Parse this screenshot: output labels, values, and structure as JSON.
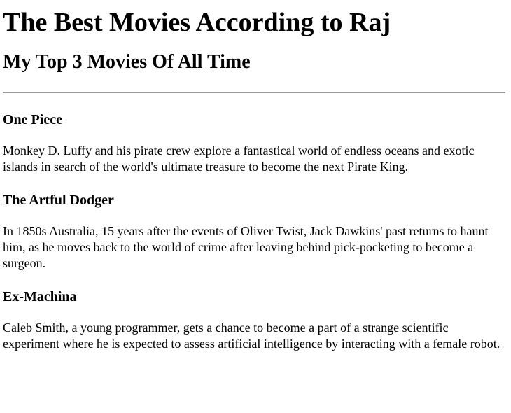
{
  "header": {
    "title": "The Best Movies According to Raj",
    "subtitle": "My Top 3 Movies Of All Time"
  },
  "movies": [
    {
      "title": "One Piece",
      "description": "Monkey D. Luffy and his pirate crew explore a fantastical world of endless oceans and exotic islands in search of the world's ultimate treasure to become the next Pirate King."
    },
    {
      "title": "The Artful Dodger",
      "description": "In 1850s Australia, 15 years after the events of Oliver Twist, Jack Dawkins' past returns to haunt him, as he moves back to the world of crime after leaving behind pick-pocketing to become a surgeon."
    },
    {
      "title": "Ex-Machina",
      "description": "Caleb Smith, a young programmer, gets a chance to become a part of a strange scientific experiment where he is expected to assess artificial intelligence by interacting with a female robot."
    }
  ]
}
